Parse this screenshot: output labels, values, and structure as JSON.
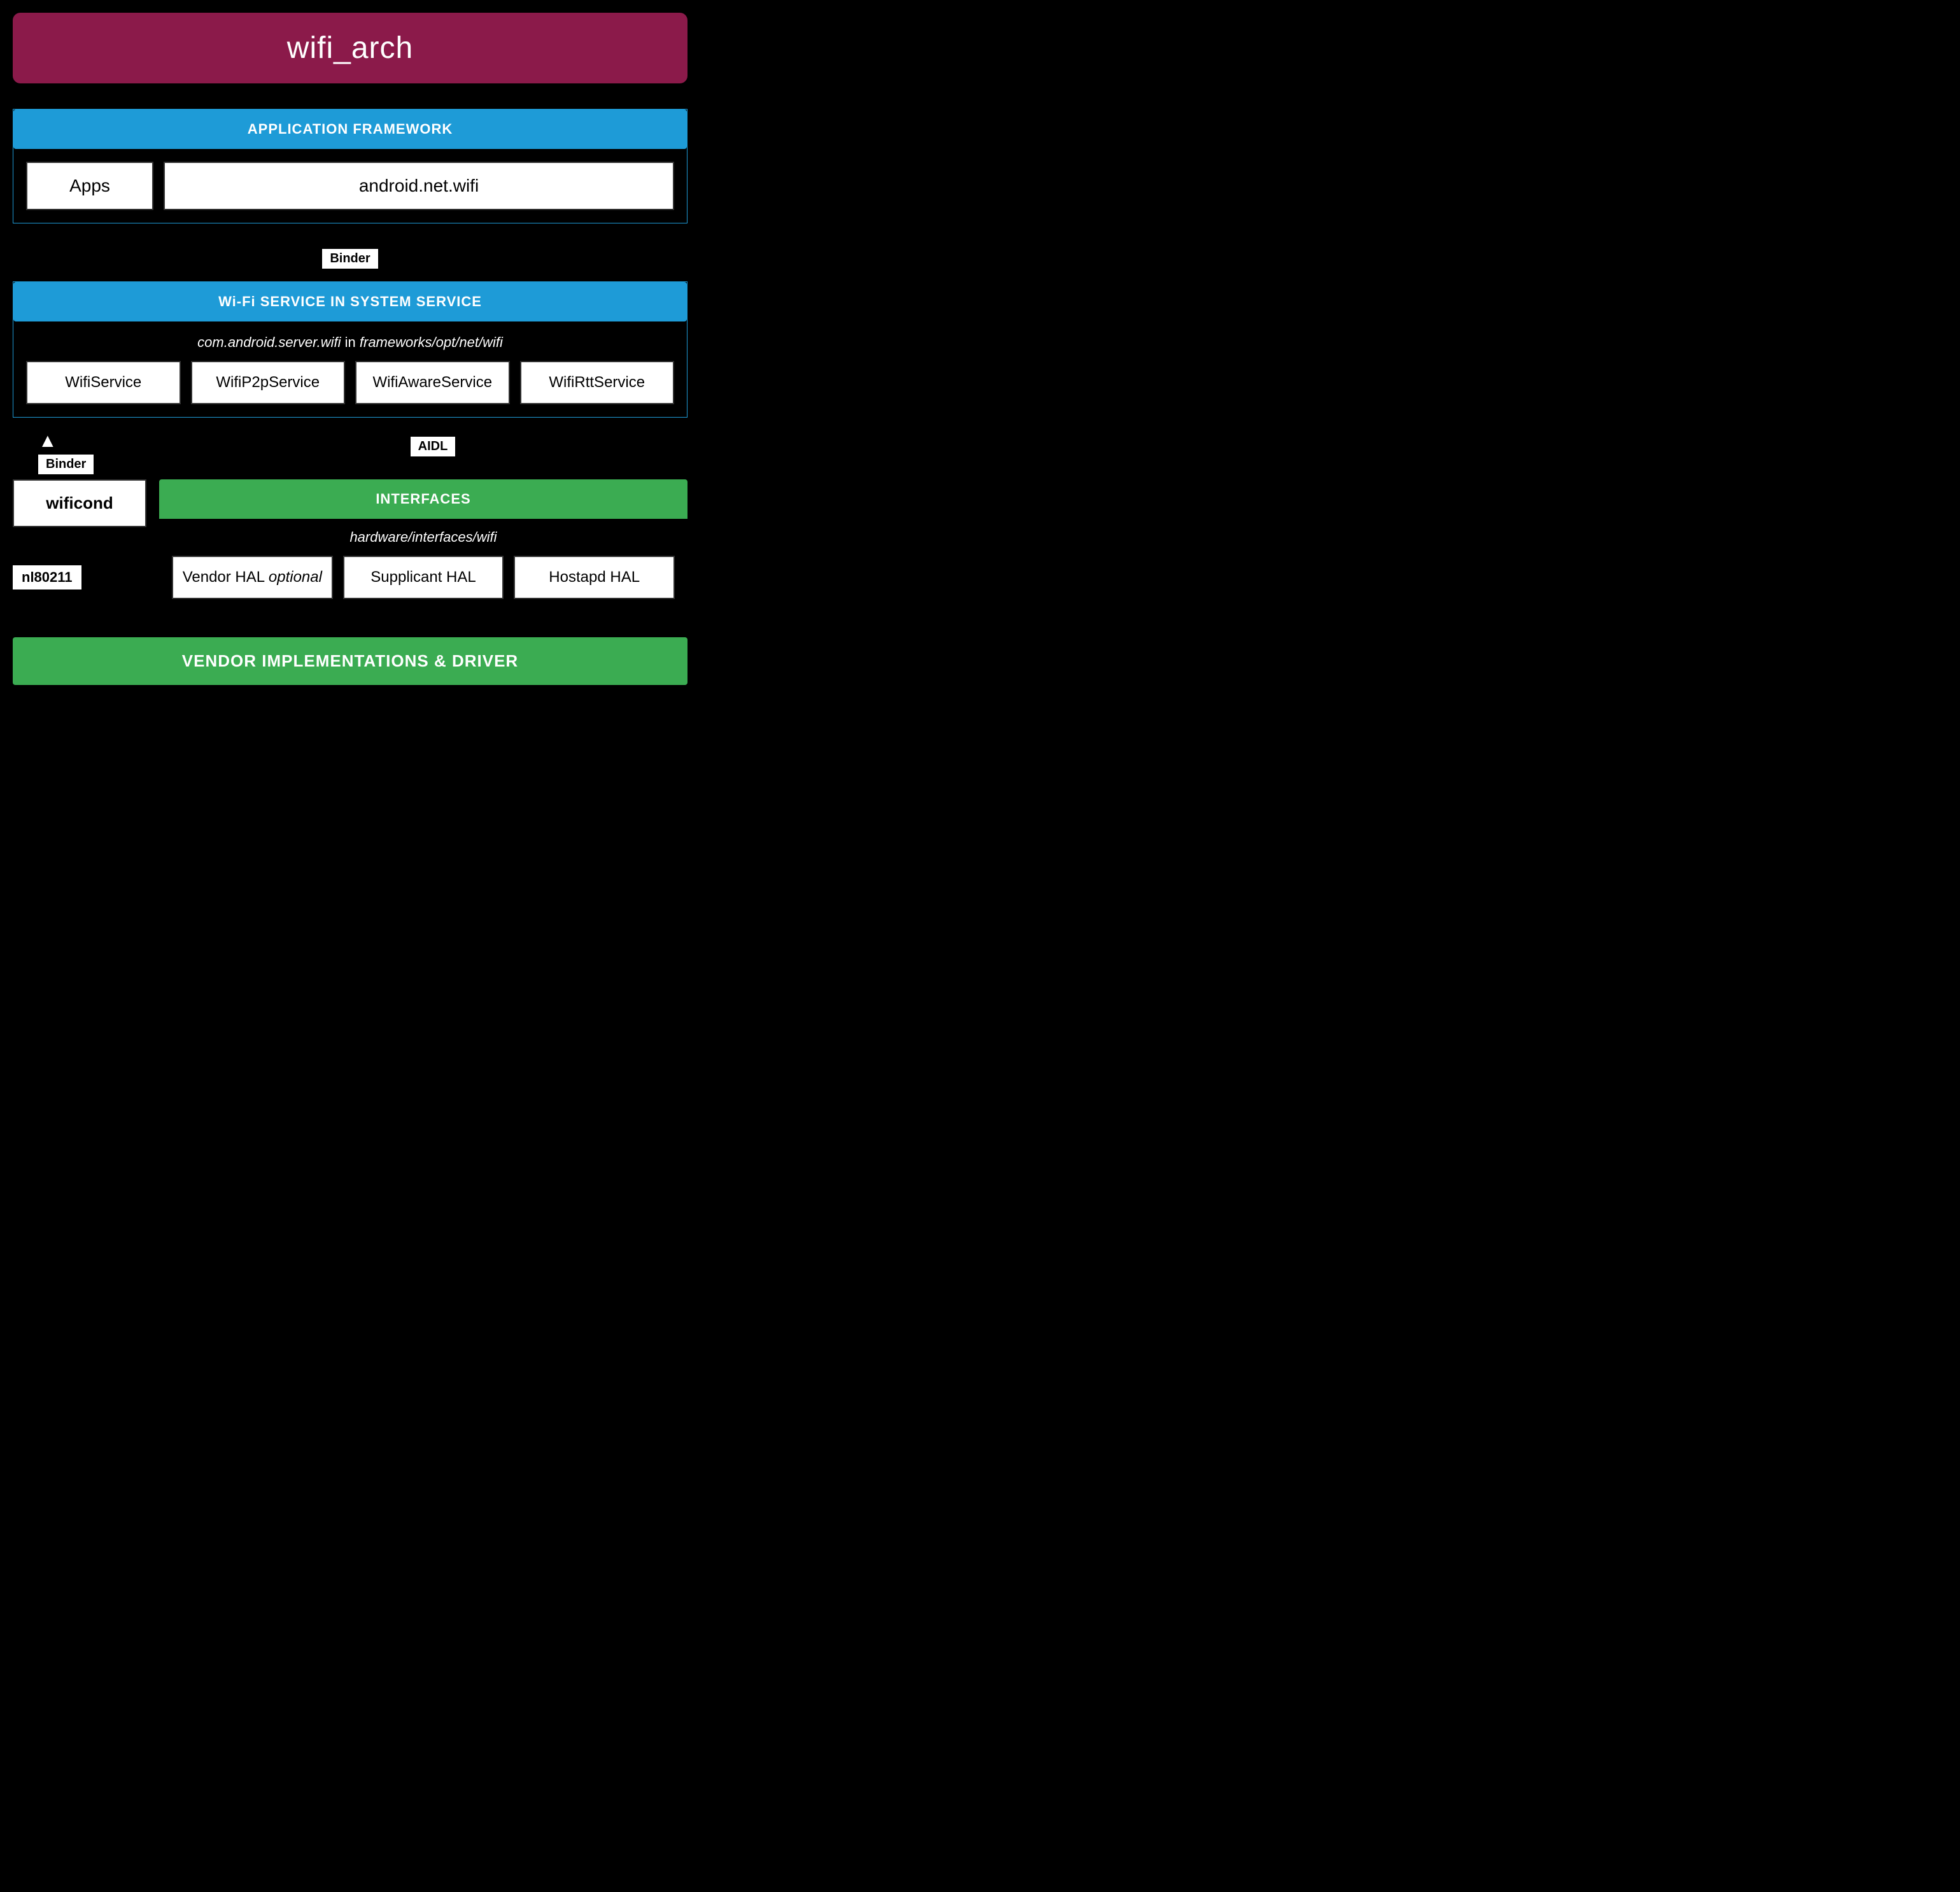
{
  "title": "wifi_arch",
  "app_framework": {
    "header": "APPLICATION FRAMEWORK",
    "apps_label": "Apps",
    "android_net_wifi_label": "android.net.wifi"
  },
  "binder_labels": {
    "binder1": "Binder",
    "binder2": "Binder",
    "aidl": "AIDL"
  },
  "wifi_service": {
    "header": "Wi-Fi SERVICE IN SYSTEM SERVICE",
    "subtitle_italic": "com.android.server.wifi",
    "subtitle_in": " in ",
    "subtitle_path": "frameworks/opt/net/wifi",
    "services": [
      "WifiService",
      "WifiP2pService",
      "WifiAwareService",
      "WifiRttService"
    ]
  },
  "lower": {
    "wificond_label": "wificond",
    "nl80211_label": "nl80211",
    "interfaces": {
      "header": "INTERFACES",
      "subtitle": "hardware/interfaces/wifi",
      "items": [
        "Vendor HAL (optional)",
        "Supplicant HAL",
        "Hostapd HAL"
      ]
    }
  },
  "vendor_impl": {
    "label": "VENDOR IMPLEMENTATIONS & DRIVER"
  }
}
